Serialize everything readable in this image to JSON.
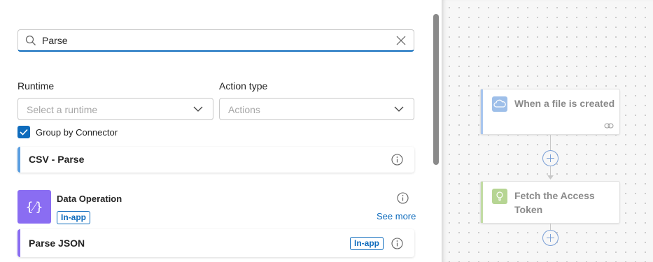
{
  "search": {
    "value": "Parse"
  },
  "filters": {
    "runtime_label": "Runtime",
    "runtime_placeholder": "Select a runtime",
    "action_type_label": "Action type",
    "action_type_placeholder": "Actions"
  },
  "group_by": {
    "label": "Group by Connector",
    "checked": true
  },
  "results": {
    "csv_card": {
      "title": "CSV - Parse"
    },
    "connector": {
      "name": "Data Operation",
      "icon_glyph": "{⁄}",
      "badge": "In-app",
      "see_more": "See more"
    },
    "parse_json": {
      "title": "Parse JSON",
      "badge": "In-app"
    }
  },
  "designer": {
    "trigger": {
      "title": "When a file is created"
    },
    "action": {
      "title_line1": "Fetch the Access",
      "title_line2": "Token"
    }
  },
  "colors": {
    "accent": "#0f6cbd",
    "csv_bar": "#5a9ee0",
    "data_operation": "#8a6df2",
    "trigger_stripe": "#a9c6ef",
    "action_stripe": "#c2dca4"
  }
}
